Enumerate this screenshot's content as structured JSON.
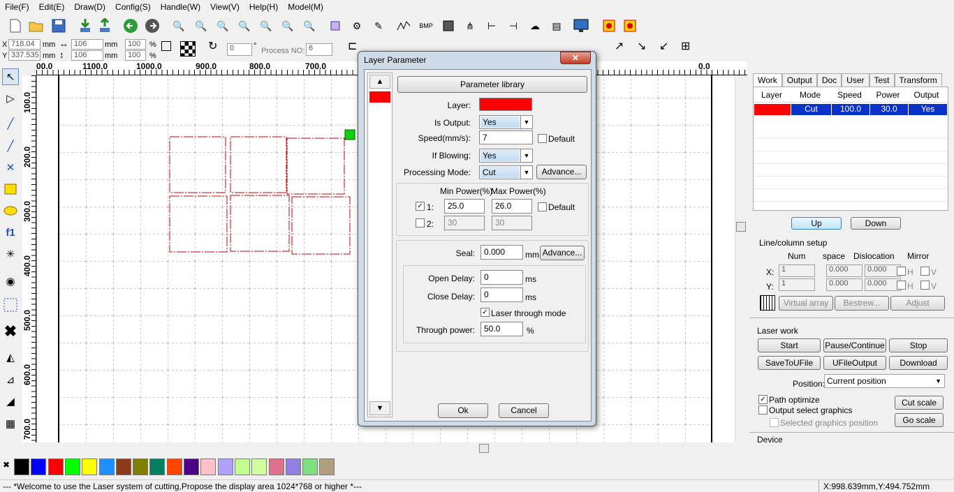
{
  "menu": [
    "File(F)",
    "Edit(E)",
    "Draw(D)",
    "Config(S)",
    "Handle(W)",
    "View(V)",
    "Help(H)",
    "Model(M)"
  ],
  "props": {
    "x_label": "X",
    "x_value": "718.04",
    "y_label": "Y",
    "y_value": "337.535",
    "unit": "mm",
    "w_value": "106",
    "h_value": "106",
    "wp": "100",
    "hp": "100",
    "pct": "%",
    "angle": "0",
    "deg": "°",
    "process_no_label": "Process NO:",
    "process_no": "6"
  },
  "ruler_h": [
    "00.0",
    "1100.0",
    "1000.0",
    "900.0",
    "800.0",
    "700.0",
    "0.0"
  ],
  "ruler_v": [
    "100.0",
    "200.0",
    "300.0",
    "400.0",
    "500.0",
    "600.0",
    "700.0"
  ],
  "palette": [
    "#000000",
    "#0000ff",
    "#ff0000",
    "#00ff00",
    "#ffff00",
    "#1e90ff",
    "#8b3a1a",
    "#808000",
    "#008060",
    "#ff4500",
    "#4b0082",
    "#ffc0cb",
    "#b0a0ff",
    "#c0ff90",
    "#d0ffa0",
    "#e07090",
    "#9080e0",
    "#80e080",
    "#b0a080"
  ],
  "status": {
    "message": "--- *Welcome to use the Laser system of cutting,Propose the display area 1024*768 or higher *---",
    "coords": "X:998.639mm,Y:494.752mm"
  },
  "right": {
    "tabs": [
      "Work",
      "Output",
      "Doc",
      "User",
      "Test",
      "Transform"
    ],
    "table_headers": [
      "Layer",
      "Mode",
      "Speed",
      "Power",
      "Output"
    ],
    "row": {
      "mode": "Cut",
      "speed": "100.0",
      "power": "30.0",
      "output": "Yes"
    },
    "up": "Up",
    "down": "Down",
    "line_col": "Line/column setup",
    "col_headers": [
      "Num",
      "space",
      "Dislocation",
      "Mirror"
    ],
    "x_label": "X:",
    "y_label": "Y:",
    "x_num": "1",
    "x_space": "0.000",
    "x_disl": "0.000",
    "y_num": "1",
    "y_space": "0.000",
    "y_disl": "0.000",
    "h": "H",
    "v": "V",
    "virtual_array": "Virtual array",
    "bestrew": "Bestrew...",
    "adjust": "Adjust",
    "laser_work": "Laser work",
    "start": "Start",
    "pause": "Pause/Continue",
    "stop": "Stop",
    "save_u": "SaveToUFile",
    "ufile_out": "UFileOutput",
    "download": "Download",
    "position_label": "Position:",
    "position_value": "Current position",
    "path_opt": "Path optimize",
    "output_sel": "Output select graphics",
    "sel_pos": "Selected graphics position",
    "cut_scale": "Cut scale",
    "go_scale": "Go scale",
    "device": "Device",
    "layer_color": "#ff0000"
  },
  "dialog": {
    "title": "Layer Parameter",
    "close": "✕",
    "param_lib": "Parameter library",
    "layer_label": "Layer:",
    "layer_color": "#ff0000",
    "is_output_label": "Is Output:",
    "is_output": "Yes",
    "speed_label": "Speed(mm/s):",
    "speed": "7",
    "default": "Default",
    "blowing_label": "If Blowing:",
    "blowing": "Yes",
    "mode_label": "Processing Mode:",
    "mode": "Cut",
    "advance": "Advance...",
    "min_power": "Min Power(%)",
    "max_power": "Max Power(%)",
    "p1_label": "1:",
    "p1_min": "25.0",
    "p1_max": "26.0",
    "p2_label": "2:",
    "p2_min": "30",
    "p2_max": "30",
    "seal_label": "Seal:",
    "seal": "0.000",
    "mm": "mm",
    "ms": "ms",
    "open_delay_label": "Open Delay:",
    "open_delay": "0",
    "close_delay_label": "Close Delay:",
    "close_delay": "0",
    "laser_through": "Laser through mode",
    "through_power_label": "Through power:",
    "through_power": "50.0",
    "pct": "%",
    "ok": "Ok",
    "cancel": "Cancel"
  }
}
